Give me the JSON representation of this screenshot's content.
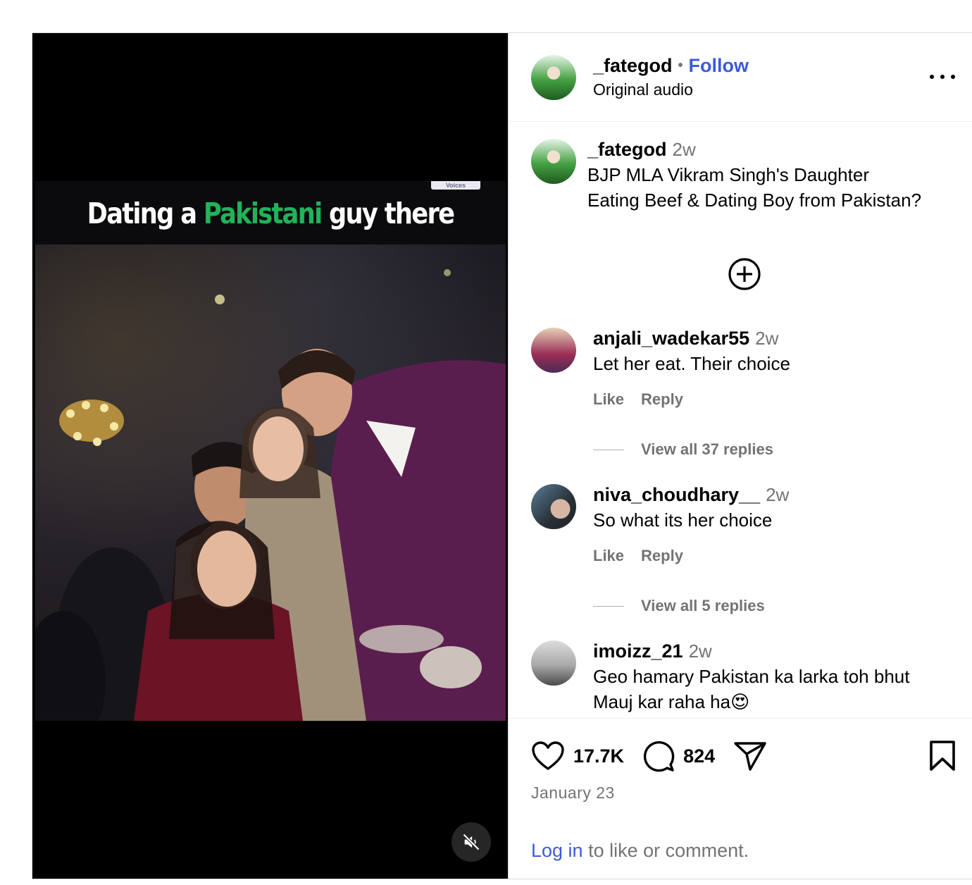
{
  "post": {
    "media": {
      "overlay_caption_part1": "Dating a ",
      "overlay_caption_highlight": "Pakistani",
      "overlay_caption_part2": " guy there",
      "watermark": "Voices",
      "mute_icon": "speaker-muted-icon"
    },
    "header": {
      "username": "_fategod",
      "separator": "•",
      "follow_label": "Follow",
      "audio_label": "Original audio",
      "more_icon": "more-options-icon"
    },
    "caption": {
      "username": "_fategod",
      "time": "2w",
      "text_line1": "BJP MLA Vikram Singh's Daughter",
      "text_line2": "Eating Beef & Dating Boy from Pakistan?"
    },
    "load_more_icon": "plus-circle-icon",
    "comments": [
      {
        "username": "anjali_wadekar55",
        "time": "2w",
        "text": "Let her eat. Their choice",
        "like_label": "Like",
        "reply_label": "Reply",
        "view_replies": "View all 37 replies"
      },
      {
        "username": "niva_choudhary__",
        "time": "2w",
        "text": "So what its her choice",
        "like_label": "Like",
        "reply_label": "Reply",
        "view_replies": "View all 5 replies"
      },
      {
        "username": "imoizz_21",
        "time": "2w",
        "text_line1": "Geo hamary Pakistan ka larka toh bhut",
        "text_line2": "Mauj kar raha ha",
        "emoji": "😍"
      }
    ],
    "footer": {
      "like_count": "17.7K",
      "comment_count": "824",
      "date": "January 23",
      "login_link": "Log in",
      "login_suffix": " to like or comment.",
      "icons": [
        "heart-icon",
        "comment-icon",
        "share-icon",
        "bookmark-icon"
      ]
    },
    "colors": {
      "link_blue": "#3b5bdb",
      "muted_text": "#737373",
      "overlay_highlight": "#22b25a"
    }
  }
}
